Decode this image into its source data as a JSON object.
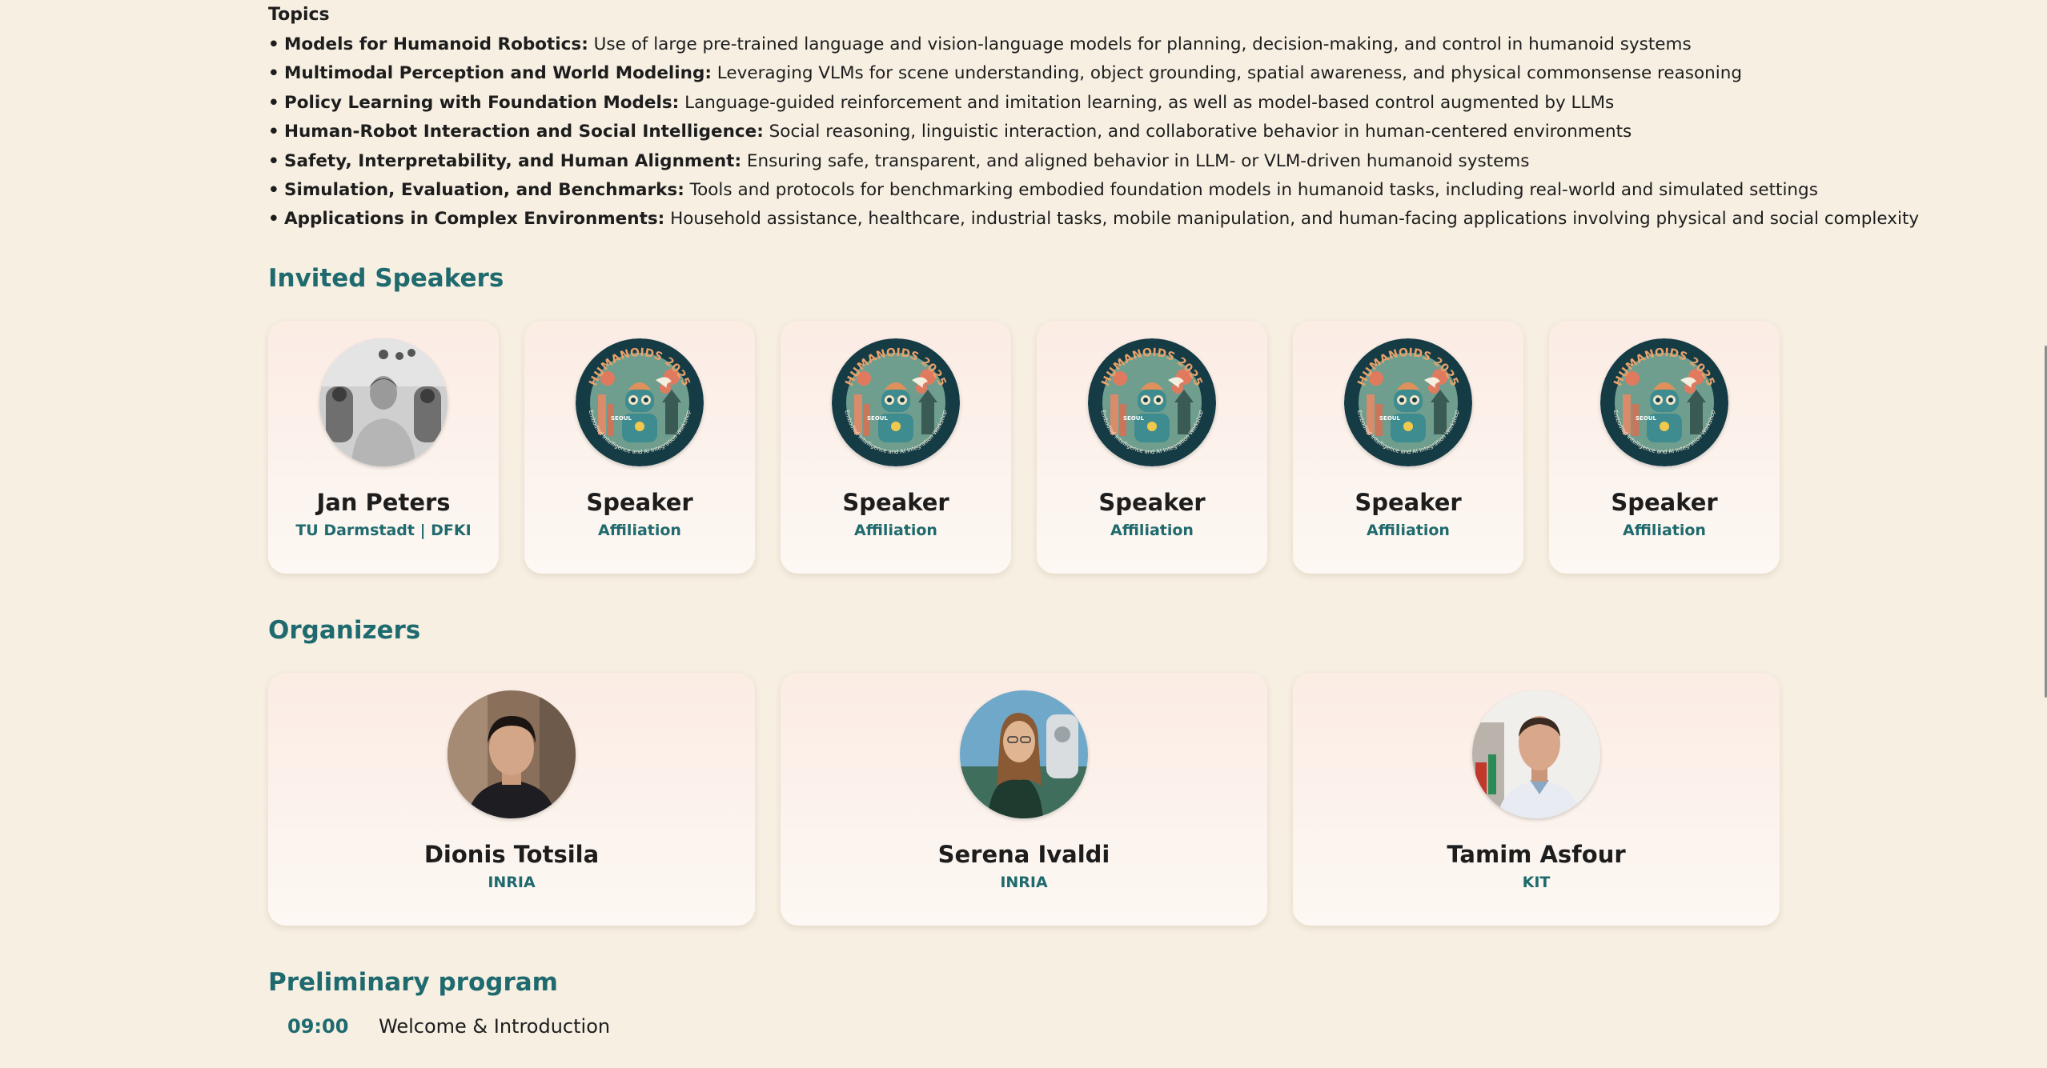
{
  "topics": {
    "heading": "Topics",
    "items": [
      {
        "title": "Models for Humanoid Robotics:",
        "text": " Use of large pre-trained language and vision-language models for planning, decision-making, and control in humanoid systems"
      },
      {
        "title": "Multimodal Perception and World Modeling:",
        "text": " Leveraging VLMs for scene understanding, object grounding, spatial awareness, and physical commonsense reasoning"
      },
      {
        "title": "Policy Learning with Foundation Models:",
        "text": " Language-guided reinforcement and imitation learning, as well as model-based control augmented by LLMs"
      },
      {
        "title": "Human-Robot Interaction and Social Intelligence:",
        "text": " Social reasoning, linguistic interaction, and collaborative behavior in human-centered environments"
      },
      {
        "title": "Safety, Interpretability, and Human Alignment:",
        "text": " Ensuring safe, transparent, and aligned behavior in LLM- or VLM-driven humanoid systems"
      },
      {
        "title": "Simulation, Evaluation, and Benchmarks:",
        "text": " Tools and protocols for benchmarking embodied foundation models in humanoid tasks, including real-world and simulated settings"
      },
      {
        "title": "Applications in Complex Environments:",
        "text": " Household assistance, healthcare, industrial tasks, mobile manipulation, and human-facing applications involving physical and social complexity"
      }
    ]
  },
  "speakers": {
    "heading": "Invited Speakers",
    "items": [
      {
        "name": "Jan Peters",
        "affiliation": "TU Darmstadt | DFKI",
        "photo": "person-photo"
      },
      {
        "name": "Speaker",
        "affiliation": "Affiliation",
        "photo": "workshop-logo"
      },
      {
        "name": "Speaker",
        "affiliation": "Affiliation",
        "photo": "workshop-logo"
      },
      {
        "name": "Speaker",
        "affiliation": "Affiliation",
        "photo": "workshop-logo"
      },
      {
        "name": "Speaker",
        "affiliation": "Affiliation",
        "photo": "workshop-logo"
      },
      {
        "name": "Speaker",
        "affiliation": "Affiliation",
        "photo": "workshop-logo"
      }
    ]
  },
  "organizers": {
    "heading": "Organizers",
    "items": [
      {
        "name": "Dionis Totsila",
        "affiliation": "INRIA",
        "photo": "person-photo"
      },
      {
        "name": "Serena Ivaldi",
        "affiliation": "INRIA",
        "photo": "person-photo"
      },
      {
        "name": "Tamim Asfour",
        "affiliation": "KIT",
        "photo": "person-photo"
      }
    ]
  },
  "program": {
    "heading": "Preliminary program",
    "items": [
      {
        "time": "09:00",
        "title": "Welcome & Introduction"
      }
    ]
  },
  "logo_text": {
    "top": "HUMANOIDS 2025",
    "city": "SEOUL",
    "bottom": "Embodied Intelligence and AI Integration Workshop"
  },
  "colors": {
    "background": "#f6efe2",
    "accent": "#1f6a6e",
    "text": "#1d1d1d",
    "card_top": "#fbece4",
    "card_bottom": "#fdf8f3"
  }
}
